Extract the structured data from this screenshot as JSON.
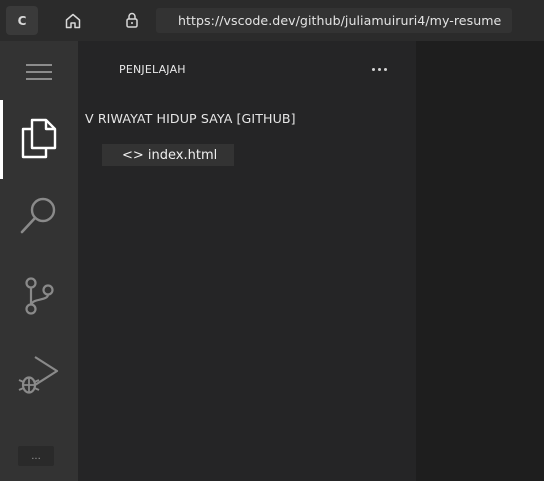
{
  "browser": {
    "tab_letter": "C",
    "url": "https://vscode.dev/github/juliamuiruri4/my-resume"
  },
  "activity_bar": {
    "items": [
      {
        "name": "menu",
        "icon": "hamburger-icon"
      },
      {
        "name": "explorer",
        "icon": "files-icon",
        "active": true
      },
      {
        "name": "search",
        "icon": "search-icon"
      },
      {
        "name": "source-control",
        "icon": "source-control-icon"
      },
      {
        "name": "run-and-debug",
        "icon": "run-debug-icon"
      }
    ],
    "bottom_label": "..."
  },
  "sidebar": {
    "title": "PENJELAJAH",
    "folder": "V RIWAYAT HIDUP SAYA [GITHUB]",
    "files": [
      {
        "label": "<> index.html"
      }
    ]
  },
  "colors": {
    "activity_bar": "#333333",
    "sidebar": "#252526",
    "editor": "#1e1e1e",
    "topbar": "#2b2b2b",
    "active_indicator": "#ffffff"
  }
}
